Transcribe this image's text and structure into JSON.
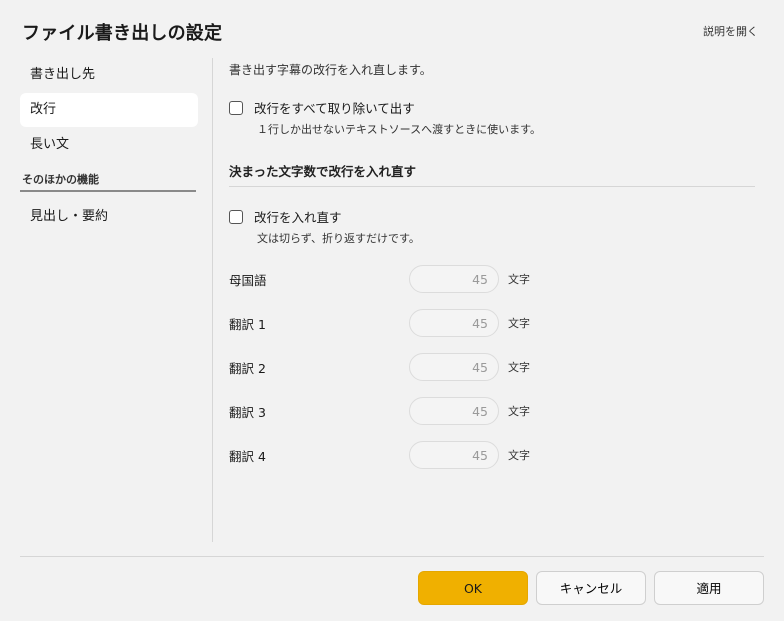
{
  "dialog": {
    "title": "ファイル書き出しの設定",
    "help_link": "説明を開く"
  },
  "sidebar": {
    "items": [
      {
        "label": "書き出し先",
        "active": false
      },
      {
        "label": "改行",
        "active": true
      },
      {
        "label": "長い文",
        "active": false
      }
    ],
    "section_label": "そのほかの機能",
    "section_items": [
      {
        "label": "見出し・要約"
      }
    ]
  },
  "content": {
    "description": "書き出す字幕の改行を入れ直します。",
    "remove_breaks": {
      "label": "改行をすべて取り除いて出す",
      "checked": false,
      "hint": "１行しか出せないテキストソースへ渡すときに使います。"
    },
    "rewrap_heading": "決まった文字数で改行を入れ直す",
    "rewrap": {
      "label": "改行を入れ直す",
      "checked": false,
      "hint": "文は切らず、折り返すだけです。"
    },
    "languages": [
      {
        "label": "母国語",
        "value": "45",
        "unit": "文字"
      },
      {
        "label": "翻訳 1",
        "value": "45",
        "unit": "文字"
      },
      {
        "label": "翻訳 2",
        "value": "45",
        "unit": "文字"
      },
      {
        "label": "翻訳 3",
        "value": "45",
        "unit": "文字"
      },
      {
        "label": "翻訳 4",
        "value": "45",
        "unit": "文字"
      }
    ]
  },
  "footer": {
    "ok_label": "OK",
    "cancel_label": "キャンセル",
    "apply_label": "適用"
  },
  "colors": {
    "accent": "#f0b000",
    "background": "#f2f2f2",
    "active_item": "#ffffff"
  }
}
